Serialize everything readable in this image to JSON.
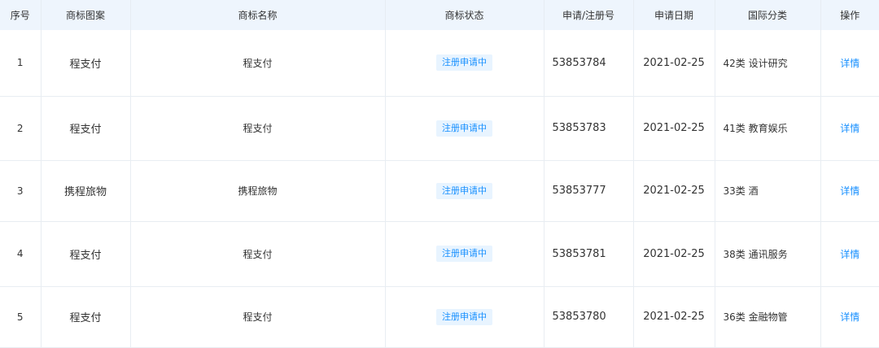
{
  "headers": {
    "index": "序号",
    "logo": "商标图案",
    "name": "商标名称",
    "status": "商标状态",
    "reg_no": "申请/注册号",
    "date": "申请日期",
    "intl_class": "国际分类",
    "action": "操作"
  },
  "rows": [
    {
      "index": "1",
      "logo": "程支付",
      "name": "程支付",
      "status": "注册申请中",
      "reg_no": "53853784",
      "date": "2021-02-25",
      "intl_class": "42类 设计研究",
      "action": "详情"
    },
    {
      "index": "2",
      "logo": "程支付",
      "name": "程支付",
      "status": "注册申请中",
      "reg_no": "53853783",
      "date": "2021-02-25",
      "intl_class": "41类 教育娱乐",
      "action": "详情"
    },
    {
      "index": "3",
      "logo": "携程旅物",
      "name": "携程旅物",
      "status": "注册申请中",
      "reg_no": "53853777",
      "date": "2021-02-25",
      "intl_class": "33类 酒",
      "action": "详情"
    },
    {
      "index": "4",
      "logo": "程支付",
      "name": "程支付",
      "status": "注册申请中",
      "reg_no": "53853781",
      "date": "2021-02-25",
      "intl_class": "38类 通讯服务",
      "action": "详情"
    },
    {
      "index": "5",
      "logo": "程支付",
      "name": "程支付",
      "status": "注册申请中",
      "reg_no": "53853780",
      "date": "2021-02-25",
      "intl_class": "36类 金融物管",
      "action": "详情"
    }
  ],
  "colors": {
    "header_bg": "#eef5fd",
    "accent": "#1890ff",
    "badge_bg": "#e8f4ff",
    "border": "#e8edf2"
  }
}
